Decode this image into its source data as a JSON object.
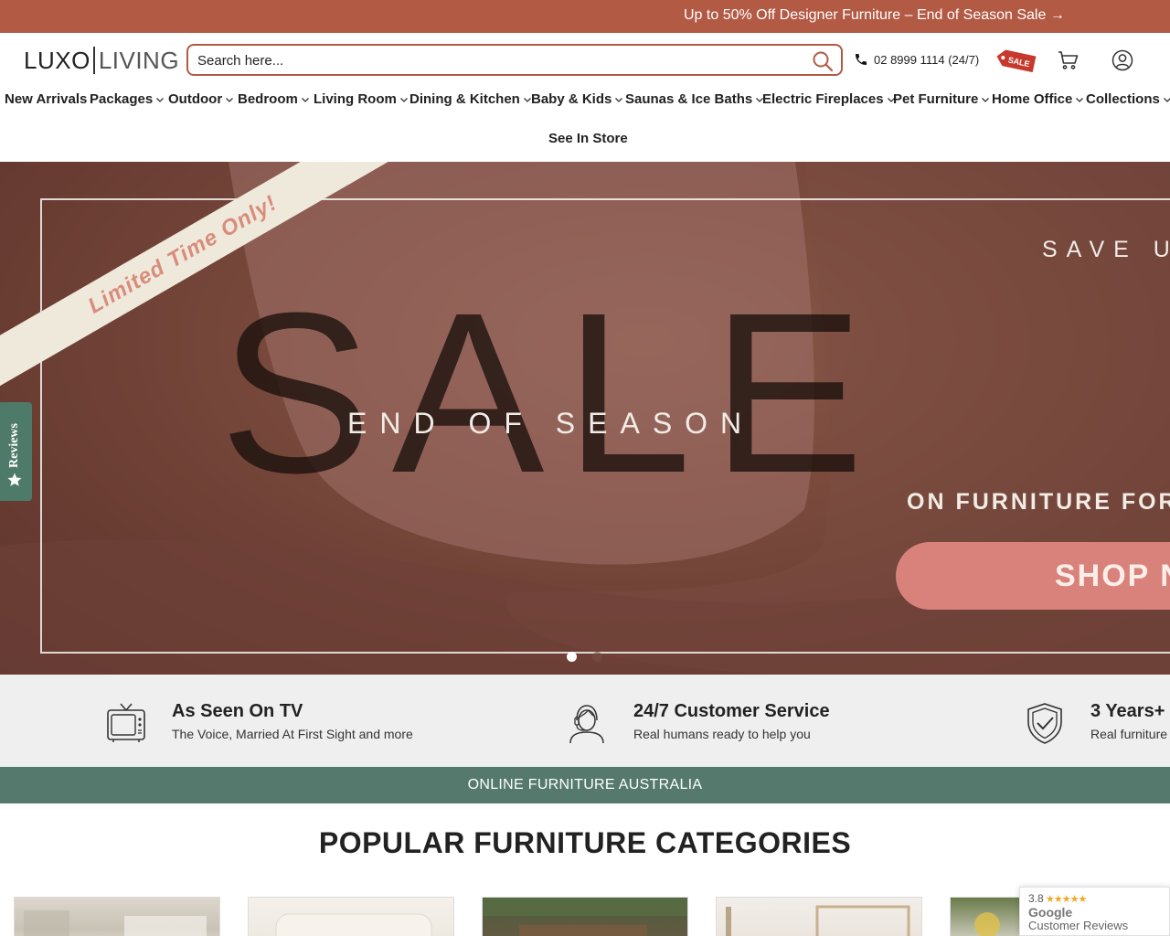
{
  "promo": {
    "text": "Up to 50% Off Designer Furniture – End of Season Sale →"
  },
  "header": {
    "logo_left": "LUXO",
    "logo_right": "LIVING",
    "search_placeholder": "Search here...",
    "phone": "02 8999 1114  (24/7)",
    "sale_tag": "SALE"
  },
  "nav": {
    "items": [
      {
        "label": "New Arrivals",
        "dropdown": false
      },
      {
        "label": "Packages",
        "dropdown": true
      },
      {
        "label": "Outdoor",
        "dropdown": true
      },
      {
        "label": "Bedroom",
        "dropdown": true
      },
      {
        "label": "Living Room",
        "dropdown": true
      },
      {
        "label": "Dining & Kitchen",
        "dropdown": true
      },
      {
        "label": "Baby & Kids",
        "dropdown": true
      },
      {
        "label": "Saunas & Ice Baths",
        "dropdown": true
      },
      {
        "label": "Electric Fireplaces",
        "dropdown": true
      },
      {
        "label": "Pet Furniture",
        "dropdown": true
      },
      {
        "label": "Home Office",
        "dropdown": true
      },
      {
        "label": "Collections",
        "dropdown": true
      }
    ],
    "see_in_store": "See In Store"
  },
  "hero": {
    "ribbon": "Limited Time Only!",
    "big_word": "SALE",
    "subtitle": "END OF SEASON",
    "save_text": "SAVE U",
    "on_text": "ON FURNITURE FOR",
    "button": "SHOP N",
    "slides": 2,
    "active_slide": 1
  },
  "reviews_tab": {
    "label": "Reviews"
  },
  "features": [
    {
      "icon": "tv-icon",
      "title": "As Seen On TV",
      "subtitle": "The Voice, Married At First Sight and more"
    },
    {
      "icon": "customer-service-icon",
      "title": "24/7 Customer Service",
      "subtitle": "Real humans ready to help you"
    },
    {
      "icon": "shield-check-icon",
      "title": "3 Years+",
      "subtitle": "Real furniture"
    }
  ],
  "band": {
    "text": "ONLINE FURNITURE AUSTRALIA"
  },
  "categories": {
    "heading": "POPULAR FURNITURE CATEGORIES"
  },
  "google": {
    "rating": "3.8",
    "stars": "★★★★★",
    "name": "Google",
    "subtitle": "Customer Reviews"
  },
  "colors": {
    "brand": "#b35a45",
    "green": "#557a6d",
    "salmon": "#d9827c"
  }
}
